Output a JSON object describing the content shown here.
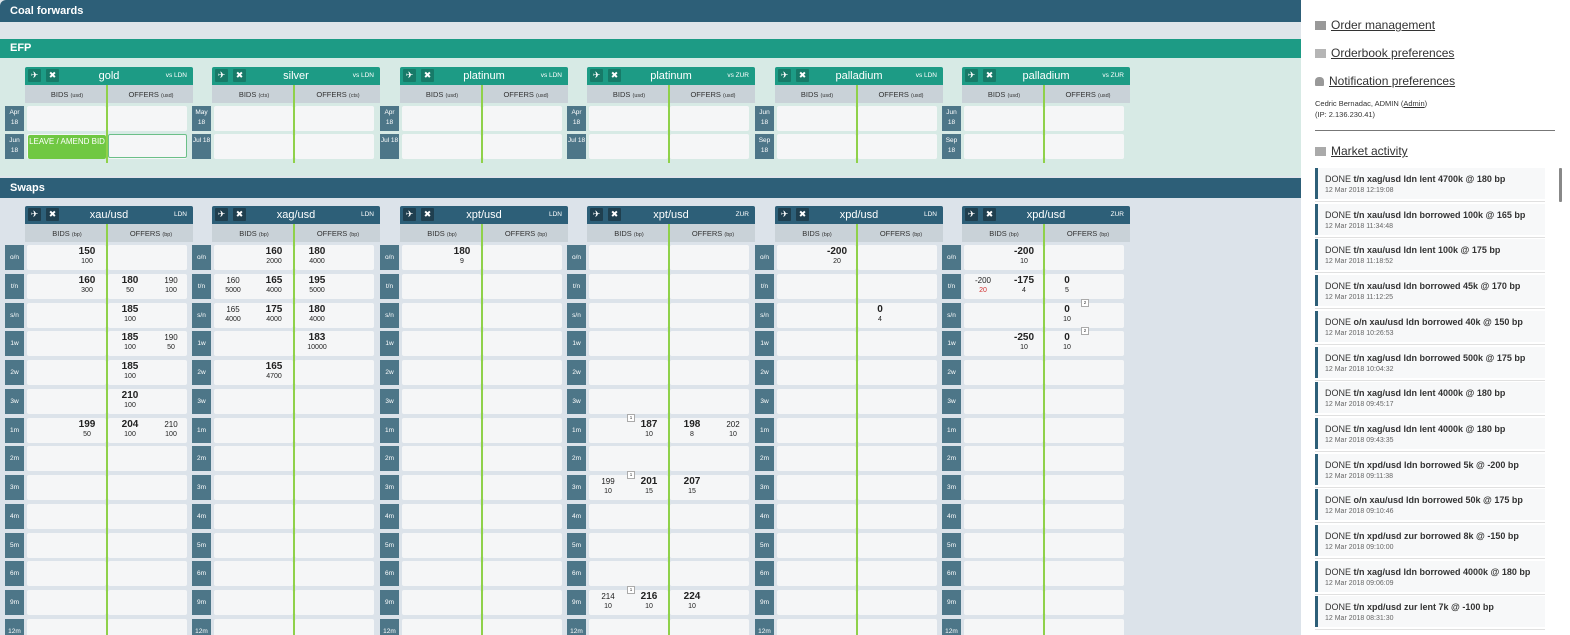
{
  "sections": {
    "coal": "Coal forwards",
    "efp": "EFP",
    "swaps": "Swaps"
  },
  "efp": {
    "panels": [
      {
        "title": "gold",
        "vs": "vs LDN",
        "bids": "BIDS",
        "bids_unit": "(usd)",
        "offers": "OFFERS",
        "offers_unit": "(usd)",
        "tenors": [
          "Apr 18",
          "Jun 18"
        ]
      },
      {
        "title": "silver",
        "vs": "vs LDN",
        "bids": "BIDS",
        "bids_unit": "(cts)",
        "offers": "OFFERS",
        "offers_unit": "(cts)",
        "tenors": [
          "May 18",
          "Jul 18"
        ]
      },
      {
        "title": "platinum",
        "vs": "vs LDN",
        "bids": "BIDS",
        "bids_unit": "(usd)",
        "offers": "OFFERS",
        "offers_unit": "(usd)",
        "tenors": [
          "Apr 18",
          "Jul 18"
        ]
      },
      {
        "title": "platinum",
        "vs": "vs ZUR",
        "bids": "BIDS",
        "bids_unit": "(usd)",
        "offers": "OFFERS",
        "offers_unit": "(usd)",
        "tenors": [
          "Apr 18",
          "Jul 18"
        ]
      },
      {
        "title": "palladium",
        "vs": "vs LDN",
        "bids": "BIDS",
        "bids_unit": "(usd)",
        "offers": "OFFERS",
        "offers_unit": "(usd)",
        "tenors": [
          "Jun 18",
          "Sep 18"
        ]
      },
      {
        "title": "palladium",
        "vs": "vs ZUR",
        "bids": "BIDS",
        "bids_unit": "(usd)",
        "offers": "OFFERS",
        "offers_unit": "(usd)",
        "tenors": [
          "Jun 18",
          "Sep 18"
        ]
      }
    ],
    "leave_button": "LEAVE / AMEND BID"
  },
  "swaps": {
    "tenors": [
      "o/n",
      "t/n",
      "s/n",
      "1w",
      "2w",
      "3w",
      "1m",
      "2m",
      "3m",
      "4m",
      "5m",
      "6m",
      "9m",
      "12m"
    ],
    "panels": [
      {
        "title": "xau/usd",
        "loc": "LDN",
        "bids": "BIDS",
        "bids_unit": "(bp)",
        "offers": "OFFERS",
        "offers_unit": "(bp)",
        "quotes": [
          {
            "row": 0,
            "col": "b1",
            "p": "150",
            "q": "100"
          },
          {
            "row": 1,
            "col": "b1",
            "p": "160",
            "q": "300"
          },
          {
            "row": 1,
            "col": "o1",
            "p": "180",
            "q": "50"
          },
          {
            "row": 1,
            "col": "o2",
            "p": "190",
            "q": "100"
          },
          {
            "row": 2,
            "col": "o1",
            "p": "185",
            "q": "100"
          },
          {
            "row": 3,
            "col": "o1",
            "p": "185",
            "q": "100"
          },
          {
            "row": 3,
            "col": "o2",
            "p": "190",
            "q": "50"
          },
          {
            "row": 4,
            "col": "o1",
            "p": "185",
            "q": "100"
          },
          {
            "row": 5,
            "col": "o1",
            "p": "210",
            "q": "100"
          },
          {
            "row": 6,
            "col": "b1",
            "p": "199",
            "q": "50"
          },
          {
            "row": 6,
            "col": "o1",
            "p": "204",
            "q": "100"
          },
          {
            "row": 6,
            "col": "o2",
            "p": "210",
            "q": "100"
          }
        ]
      },
      {
        "title": "xag/usd",
        "loc": "LDN",
        "bids": "BIDS",
        "bids_unit": "(bp)",
        "offers": "OFFERS",
        "offers_unit": "(bp)",
        "quotes": [
          {
            "row": 0,
            "col": "b1",
            "p": "160",
            "q": "2000"
          },
          {
            "row": 0,
            "col": "o1",
            "p": "180",
            "q": "4000"
          },
          {
            "row": 1,
            "col": "b2",
            "p": "160",
            "q": "5000"
          },
          {
            "row": 1,
            "col": "b1",
            "p": "165",
            "q": "4000"
          },
          {
            "row": 1,
            "col": "o1",
            "p": "195",
            "q": "5000"
          },
          {
            "row": 2,
            "col": "b2",
            "p": "165",
            "q": "4000"
          },
          {
            "row": 2,
            "col": "b1",
            "p": "175",
            "q": "4000"
          },
          {
            "row": 2,
            "col": "o1",
            "p": "180",
            "q": "4000"
          },
          {
            "row": 3,
            "col": "o1",
            "p": "183",
            "q": "10000"
          },
          {
            "row": 4,
            "col": "b1",
            "p": "165",
            "q": "4700"
          }
        ]
      },
      {
        "title": "xpt/usd",
        "loc": "LDN",
        "bids": "BIDS",
        "bids_unit": "(bp)",
        "offers": "OFFERS",
        "offers_unit": "(bp)",
        "quotes": [
          {
            "row": 0,
            "col": "b1",
            "p": "180",
            "q": "9"
          }
        ]
      },
      {
        "title": "xpt/usd",
        "loc": "ZUR",
        "bids": "BIDS",
        "bids_unit": "(bp)",
        "offers": "OFFERS",
        "offers_unit": "(bp)",
        "quotes": [
          {
            "row": 6,
            "col": "b1",
            "p": "187",
            "q": "10",
            "corner": "1"
          },
          {
            "row": 6,
            "col": "o1",
            "p": "198",
            "q": "8"
          },
          {
            "row": 6,
            "col": "o2",
            "p": "202",
            "q": "10"
          },
          {
            "row": 8,
            "col": "b2",
            "p": "199",
            "q": "10"
          },
          {
            "row": 8,
            "col": "b1",
            "p": "201",
            "q": "15",
            "corner": "1"
          },
          {
            "row": 8,
            "col": "o1",
            "p": "207",
            "q": "15"
          },
          {
            "row": 12,
            "col": "b2",
            "p": "214",
            "q": "10"
          },
          {
            "row": 12,
            "col": "b1",
            "p": "216",
            "q": "10",
            "corner": "1"
          },
          {
            "row": 12,
            "col": "o1",
            "p": "224",
            "q": "10"
          }
        ]
      },
      {
        "title": "xpd/usd",
        "loc": "LDN",
        "bids": "BIDS",
        "bids_unit": "(bp)",
        "offers": "OFFERS",
        "offers_unit": "(bp)",
        "quotes": [
          {
            "row": 0,
            "col": "b1",
            "p": "-200",
            "q": "20"
          },
          {
            "row": 2,
            "col": "o1",
            "p": "0",
            "q": "4"
          }
        ]
      },
      {
        "title": "xpd/usd",
        "loc": "ZUR",
        "bids": "BIDS",
        "bids_unit": "(bp)",
        "offers": "OFFERS",
        "offers_unit": "(bp)",
        "quotes": [
          {
            "row": 0,
            "col": "b1",
            "p": "-200",
            "q": "10"
          },
          {
            "row": 1,
            "col": "b2",
            "p": "-200",
            "q": "20",
            "qprefix": "x"
          },
          {
            "row": 1,
            "col": "b1",
            "p": "-175",
            "q": "4"
          },
          {
            "row": 1,
            "col": "o1",
            "p": "0",
            "q": "5"
          },
          {
            "row": 2,
            "col": "o1",
            "p": "0",
            "q": "10",
            "corner": "2"
          },
          {
            "row": 3,
            "col": "b1",
            "p": "-250",
            "q": "10"
          },
          {
            "row": 3,
            "col": "o1",
            "p": "0",
            "q": "10",
            "corner": "2"
          }
        ]
      }
    ]
  },
  "sidebar": {
    "links": [
      "Order management",
      "Orderbook preferences",
      "Notification preferences"
    ],
    "user_name": "Cedric Bernadac, ADMIN (",
    "user_role_link": "Admin",
    "user_close": ")",
    "ip": "(IP: 2.136.230.41)",
    "market_activity": "Market activity",
    "activity": [
      {
        "status": "DONE",
        "text": "t/n xag/usd ldn lent 4700k @ 180 bp",
        "date": "12 Mar 2018 12:19:08"
      },
      {
        "status": "DONE",
        "text": "t/n xau/usd ldn borrowed 100k @ 165 bp",
        "date": "12 Mar 2018 11:34:48"
      },
      {
        "status": "DONE",
        "text": "t/n xau/usd ldn lent 100k @ 175 bp",
        "date": "12 Mar 2018 11:18:52"
      },
      {
        "status": "DONE",
        "text": "t/n xau/usd ldn borrowed 45k @ 170 bp",
        "date": "12 Mar 2018 11:12:25"
      },
      {
        "status": "DONE",
        "text": "o/n xau/usd ldn borrowed 40k @ 150 bp",
        "date": "12 Mar 2018 10:26:53"
      },
      {
        "status": "DONE",
        "text": "t/n xag/usd ldn borrowed 500k @ 175 bp",
        "date": "12 Mar 2018 10:04:32"
      },
      {
        "status": "DONE",
        "text": "t/n xag/usd ldn lent 4000k @ 180 bp",
        "date": "12 Mar 2018 09:45:17"
      },
      {
        "status": "DONE",
        "text": "t/n xag/usd ldn lent 4000k @ 180 bp",
        "date": "12 Mar 2018 09:43:35"
      },
      {
        "status": "DONE",
        "text": "t/n xpd/usd ldn borrowed 5k @ -200 bp",
        "date": "12 Mar 2018 09:11:38"
      },
      {
        "status": "DONE",
        "text": "o/n xau/usd ldn borrowed 50k @ 175 bp",
        "date": "12 Mar 2018 09:10:46"
      },
      {
        "status": "DONE",
        "text": "t/n xpd/usd zur borrowed 8k @ -150 bp",
        "date": "12 Mar 2018 09:10:00"
      },
      {
        "status": "DONE",
        "text": "t/n xag/usd ldn borrowed 4000k @ 180 bp",
        "date": "12 Mar 2018 09:06:09"
      },
      {
        "status": "DONE",
        "text": "t/n xpd/usd zur lent 7k @ -100 bp",
        "date": "12 Mar 2018 08:31:30"
      }
    ]
  }
}
